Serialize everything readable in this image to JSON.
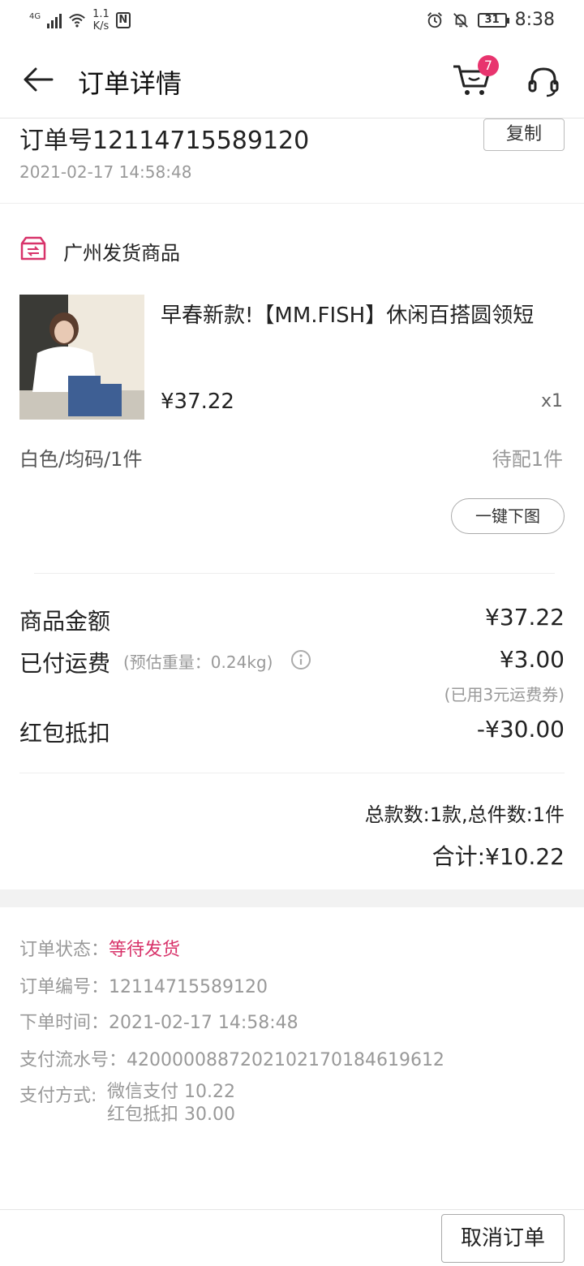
{
  "status_bar": {
    "network": "4G",
    "speed_value": "1.1",
    "speed_unit": "K/s",
    "battery": "31",
    "time": "8:38"
  },
  "header": {
    "title": "订单详情",
    "cart_badge": "7"
  },
  "order": {
    "number_label": "订单号12114715589120",
    "copy_label": "复制",
    "time": "2021-02-17 14:58:48"
  },
  "warehouse": {
    "label": "广州发货商品"
  },
  "product": {
    "title": "早春新款!【MM.FISH】休闲百搭圆领短",
    "price": "¥37.22",
    "quantity": "x1",
    "spec": "白色/均码/1件",
    "status": "待配1件",
    "download_label": "一键下图"
  },
  "amounts": {
    "goods_label": "商品金额",
    "goods_value": "¥37.22",
    "shipping_label": "已付运费",
    "shipping_note": "(预估重量：0.24kg)",
    "shipping_value": "¥3.00",
    "coupon_note": "(已用3元运费券)",
    "redpacket_label": "红包抵扣",
    "redpacket_value": "-¥30.00",
    "count_summary": "总款数:1款,总件数:1件",
    "total": "合计:¥10.22"
  },
  "info": {
    "status_label": "订单状态：",
    "status_value": "等待发货",
    "number_label": "订单编号：",
    "number_value": "12114715589120",
    "time_label": "下单时间：",
    "time_value": "2021-02-17 14:58:48",
    "txn_label": "支付流水号：",
    "txn_value": "4200000887202102170184619612",
    "pay_label": "支付方式:",
    "pay_line1": "微信支付 10.22",
    "pay_line2": "红包抵扣 30.00"
  },
  "footer": {
    "cancel_label": "取消订单"
  },
  "colors": {
    "accent": "#d8336a",
    "badge": "#e8346e"
  }
}
